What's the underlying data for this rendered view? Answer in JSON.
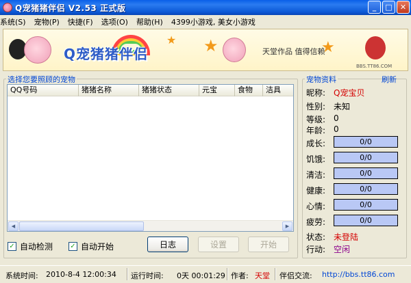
{
  "window": {
    "title": "Q宠猪猪伴侣 V2.53 正式版"
  },
  "menu": [
    "系统(S)",
    "宠物(P)",
    "快捷(F)",
    "选项(O)",
    "帮助(H)",
    "4399小游戏, 美女小游戏"
  ],
  "banner": {
    "title": "Q宠猪猪伴侣",
    "credit": "天堂作品  值得信赖",
    "url": "BBS.TT86.COM"
  },
  "pet_list": {
    "group_label": "选择您要照顾的宠物",
    "columns": [
      "QQ号码",
      "猪猪名称",
      "猪猪状态",
      "元宝",
      "食物",
      "洁具"
    ],
    "rows": []
  },
  "controls": {
    "auto_detect_label": "自动检测",
    "auto_detect_checked": true,
    "auto_start_label": "自动开始",
    "auto_start_checked": true,
    "log_button": "日志",
    "settings_button": "设置",
    "start_button": "开始"
  },
  "pet_info": {
    "group_label": "宠物资料",
    "refresh_label": "刷新",
    "nickname_label": "昵称:",
    "nickname": "Q宠宝贝",
    "gender_label": "性别:",
    "gender": "未知",
    "level_label": "等级:",
    "level": "0",
    "age_label": "年龄:",
    "age": "0",
    "stats": [
      {
        "label": "成长:",
        "value": "0/0"
      },
      {
        "label": "饥饿:",
        "value": "0/0"
      },
      {
        "label": "清洁:",
        "value": "0/0"
      },
      {
        "label": "健康:",
        "value": "0/0"
      },
      {
        "label": "心情:",
        "value": "0/0"
      },
      {
        "label": "疲劳:",
        "value": "0/0"
      }
    ],
    "state_label": "状态:",
    "state": "未登陆",
    "action_label": "行动:",
    "action": "空闲"
  },
  "statusbar": {
    "system_time_label": "系统时间:",
    "system_time": "2010-8-4 12:00:34",
    "run_time_label": "运行时间:",
    "run_time": "0天 00:01:29",
    "author_label": "作者:",
    "author": "天堂",
    "community_label": "伴侣交流:",
    "community_url": "http://bbs.tt86.com"
  },
  "colors": {
    "accent_red": "#D40000",
    "accent_purple": "#8B008B",
    "link_blue": "#0046D5",
    "stat_fill": "#B9C8F5"
  }
}
